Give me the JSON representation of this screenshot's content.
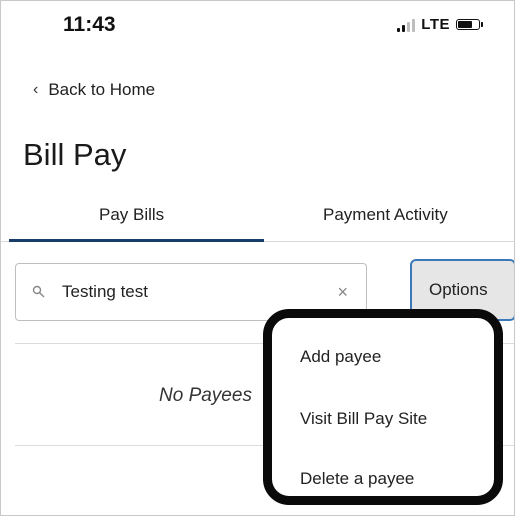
{
  "status_bar": {
    "time": "11:43",
    "network": "LTE"
  },
  "nav": {
    "back_label": "Back to Home"
  },
  "page": {
    "title": "Bill Pay"
  },
  "tabs": [
    {
      "label": "Pay Bills",
      "active": true
    },
    {
      "label": "Payment Activity",
      "active": false
    }
  ],
  "search": {
    "value": "Testing test"
  },
  "options_button": {
    "label": "Options"
  },
  "empty_state": {
    "text": "No Payees"
  },
  "options_menu": {
    "items": [
      "Add payee",
      "Visit Bill Pay Site",
      "Delete a payee"
    ]
  },
  "colors": {
    "tab_underline": "#173e68",
    "options_border": "#3b79b8"
  }
}
